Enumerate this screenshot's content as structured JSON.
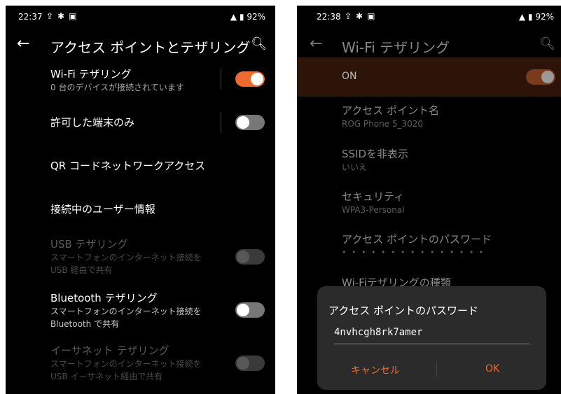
{
  "left": {
    "status": {
      "time": "22:37",
      "battery": "92%"
    },
    "title": "アクセス ポイントとテザリング",
    "items": [
      {
        "title": "Wi-Fi テザリング",
        "subtitle": "0 台のデバイスが接続されています"
      },
      {
        "title": "許可した端末のみ"
      },
      {
        "title": "QR コードネットワークアクセス"
      },
      {
        "title": "接続中のユーザー情報"
      },
      {
        "title": "USB テザリング",
        "subtitle1": "スマートフォンのインターネット接続を",
        "subtitle2": "USB 経由で共有"
      },
      {
        "title": "Bluetooth テザリング",
        "subtitle1": "スマートフォンのインターネット接続を",
        "subtitle2": "Bluetooth で共有"
      },
      {
        "title": "イーサネット テザリング",
        "subtitle1": "スマートフォンのインターネット接続を",
        "subtitle2": "USB イーサネット経由で共有"
      }
    ]
  },
  "right": {
    "status": {
      "time": "22:38",
      "battery": "92%"
    },
    "title": "Wi-Fi テザリング",
    "on_label": "ON",
    "items": [
      {
        "title": "アクセス ポイント名",
        "subtitle": "ROG Phone 5_3020"
      },
      {
        "title": "SSIDを非表示",
        "subtitle": "いいえ"
      },
      {
        "title": "セキュリティ",
        "subtitle": "WPA3-Personal"
      },
      {
        "title": "アクセス ポイントのパスワード",
        "subtitle": "• • • • • • • • • • • • • • •"
      },
      {
        "title": "Wi-Fiテザリングの種類"
      }
    ],
    "dialog": {
      "title": "アクセス ポイントのパスワード",
      "value": "4nvhcgh8rk7amer",
      "cancel": "キャンセル",
      "ok": "OK"
    }
  },
  "colors": {
    "accent": "#ee6a2f",
    "background": "#000000"
  }
}
